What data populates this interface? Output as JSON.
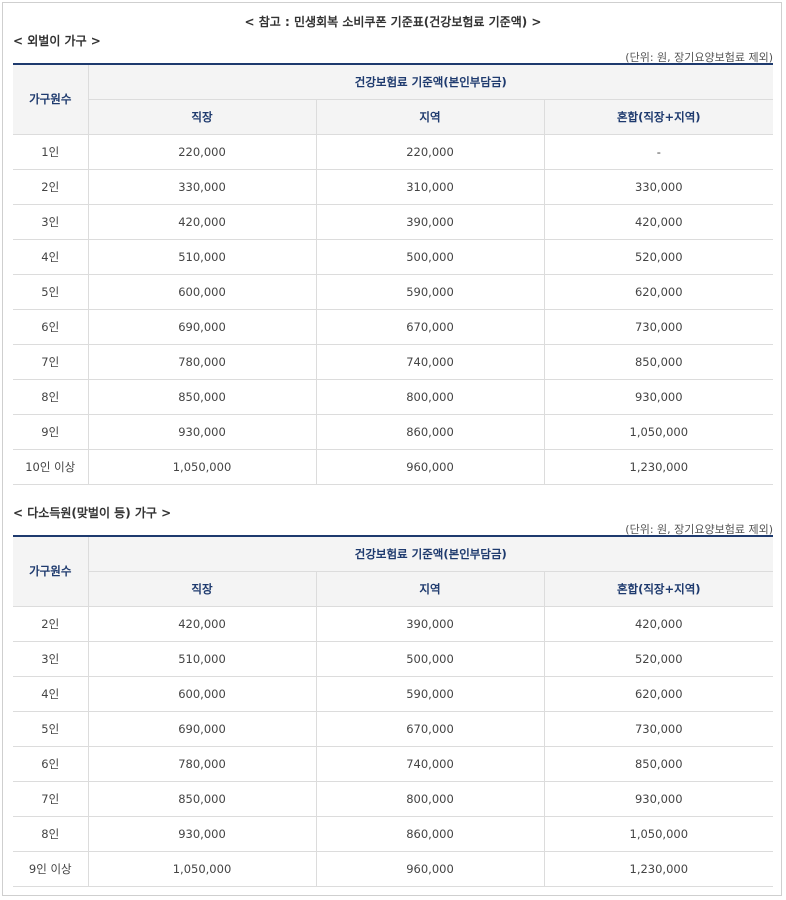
{
  "main_title": "< 참고 : 민생회복 소비쿠폰 기준표(건강보험료 기준액) >",
  "sections": [
    {
      "title": "< 외벌이 가구 >",
      "unit_note": "(단위: 원, 장기요양보험료 제외)",
      "header": {
        "row_label": "가구원수",
        "group_label": "건강보험료 기준액(본인부담금)",
        "columns": [
          "직장",
          "지역",
          "혼합(직장+지역)"
        ]
      },
      "rows": [
        [
          "1인",
          "220,000",
          "220,000",
          "-"
        ],
        [
          "2인",
          "330,000",
          "310,000",
          "330,000"
        ],
        [
          "3인",
          "420,000",
          "390,000",
          "420,000"
        ],
        [
          "4인",
          "510,000",
          "500,000",
          "520,000"
        ],
        [
          "5인",
          "600,000",
          "590,000",
          "620,000"
        ],
        [
          "6인",
          "690,000",
          "670,000",
          "730,000"
        ],
        [
          "7인",
          "780,000",
          "740,000",
          "850,000"
        ],
        [
          "8인",
          "850,000",
          "800,000",
          "930,000"
        ],
        [
          "9인",
          "930,000",
          "860,000",
          "1,050,000"
        ],
        [
          "10인 이상",
          "1,050,000",
          "960,000",
          "1,230,000"
        ]
      ]
    },
    {
      "title": "< 다소득원(맞벌이 등) 가구 >",
      "unit_note": "(단위: 원, 장기요양보험료 제외)",
      "header": {
        "row_label": "가구원수",
        "group_label": "건강보험료 기준액(본인부담금)",
        "columns": [
          "직장",
          "지역",
          "혼합(직장+지역)"
        ]
      },
      "rows": [
        [
          "2인",
          "420,000",
          "390,000",
          "420,000"
        ],
        [
          "3인",
          "510,000",
          "500,000",
          "520,000"
        ],
        [
          "4인",
          "600,000",
          "590,000",
          "620,000"
        ],
        [
          "5인",
          "690,000",
          "670,000",
          "730,000"
        ],
        [
          "6인",
          "780,000",
          "740,000",
          "850,000"
        ],
        [
          "7인",
          "850,000",
          "800,000",
          "930,000"
        ],
        [
          "8인",
          "930,000",
          "860,000",
          "1,050,000"
        ],
        [
          "9인 이상",
          "1,050,000",
          "960,000",
          "1,230,000"
        ]
      ]
    }
  ],
  "colors": {
    "header_text": "#1e3a6e",
    "header_bg": "#f4f4f4",
    "border": "#dcdcdc"
  }
}
